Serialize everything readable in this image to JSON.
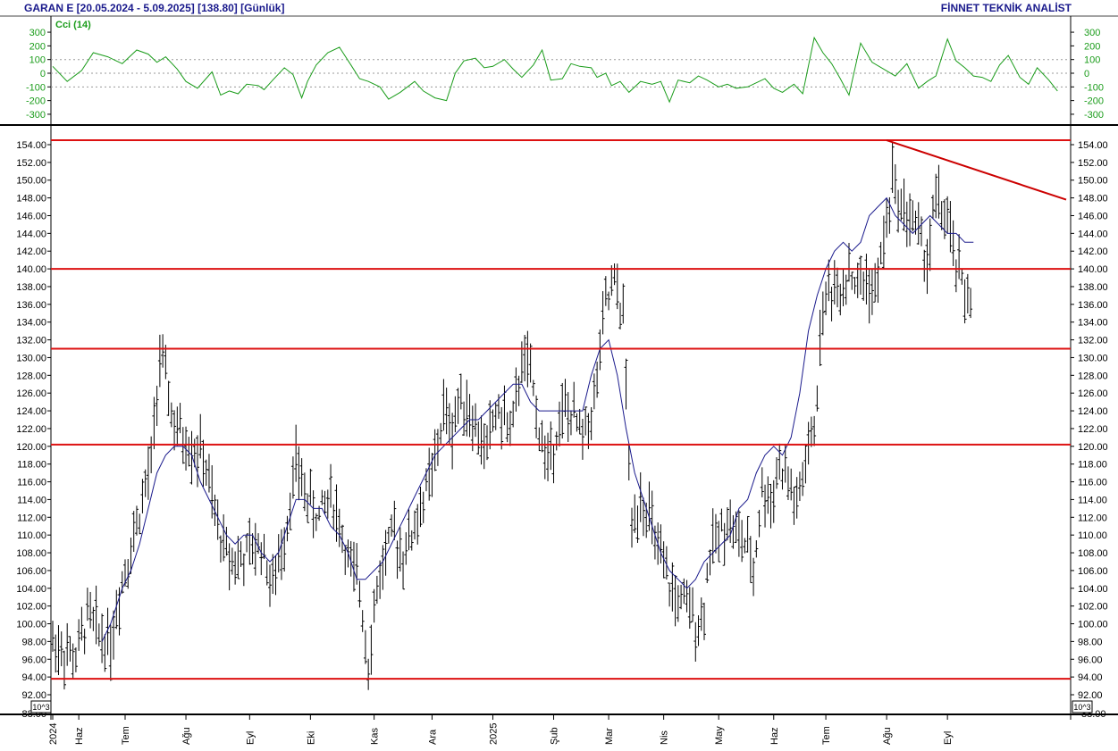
{
  "header": {
    "title": "GARAN E  [20.05.2024 - 5.09.2025]  [138.80]  [Günlük]",
    "brand": "FİNNET TEKNİK ANALİST"
  },
  "chart_data": [
    {
      "type": "line",
      "title": "Cci (14)",
      "ylim": [
        -340,
        340
      ],
      "yticks": [
        300,
        200,
        100,
        0,
        -100,
        -200,
        -300
      ],
      "ytick_labels": [
        "300",
        "200",
        "100",
        "0",
        "-100",
        "-200",
        "-300"
      ],
      "reference_lines": [
        100,
        -100
      ],
      "grid": false,
      "series": [
        {
          "name": "Cci (14)",
          "color": "#1a9c1a",
          "x": [
            0,
            5,
            10,
            14,
            19,
            24,
            29,
            33,
            36,
            39,
            43,
            46,
            50,
            55,
            58,
            61,
            64,
            67,
            71,
            73,
            76,
            80,
            83,
            86,
            88,
            91,
            95,
            99,
            103,
            106,
            109,
            113,
            116,
            120,
            125,
            128,
            132,
            136,
            139,
            142,
            146,
            149,
            152,
            156,
            159,
            162,
            166,
            169,
            172,
            176,
            179,
            182,
            186,
            188,
            191,
            193,
            196,
            199,
            203,
            207,
            210,
            213,
            216,
            220,
            223,
            226,
            230,
            233,
            236,
            240,
            243,
            246,
            249,
            252,
            256,
            259,
            263,
            266,
            269,
            272,
            275,
            279,
            283,
            287,
            291,
            295,
            299,
            302,
            305,
            309,
            312,
            315,
            318,
            321,
            324,
            327,
            330,
            334,
            337,
            340,
            344,
            347
          ],
          "values": [
            50,
            -60,
            20,
            150,
            120,
            70,
            170,
            140,
            80,
            120,
            30,
            -60,
            -110,
            10,
            -160,
            -130,
            -150,
            -80,
            -90,
            -120,
            -50,
            40,
            -10,
            -180,
            -60,
            60,
            150,
            190,
            60,
            -40,
            -60,
            -100,
            -190,
            -140,
            -60,
            -130,
            -180,
            -200,
            0,
            90,
            110,
            40,
            50,
            100,
            30,
            -30,
            60,
            170,
            -50,
            -40,
            70,
            50,
            40,
            -30,
            0,
            -90,
            -60,
            -140,
            -60,
            -80,
            -60,
            -210,
            -50,
            -70,
            -20,
            -50,
            -100,
            -80,
            -110,
            -100,
            -70,
            -40,
            -110,
            -140,
            -80,
            -150,
            260,
            150,
            70,
            -40,
            -160,
            220,
            80,
            30,
            -20,
            70,
            -110,
            -60,
            -20,
            250,
            90,
            40,
            -20,
            -30,
            -60,
            60,
            130,
            -30,
            -80,
            40,
            -50,
            -130
          ]
        }
      ]
    },
    {
      "type": "bar",
      "chart_style": "ohlc",
      "ylim": [
        88,
        156
      ],
      "yticks": [
        92,
        94,
        96,
        98,
        100,
        102,
        104,
        106,
        108,
        110,
        112,
        114,
        116,
        118,
        120,
        122,
        124,
        126,
        128,
        130,
        132,
        134,
        136,
        138,
        140,
        142,
        144,
        146,
        148,
        150,
        152,
        154
      ],
      "ytick_labels": [
        "92.00",
        "94.00",
        "96.00",
        "98.00",
        "100.00",
        "102.00",
        "104.00",
        "106.00",
        "108.00",
        "110.00",
        "112.00",
        "114.00",
        "116.00",
        "118.00",
        "120.00",
        "122.00",
        "124.00",
        "126.00",
        "128.00",
        "130.00",
        "132.00",
        "134.00",
        "136.00",
        "138.00",
        "140.00",
        "142.00",
        "144.00",
        "146.00",
        "148.00",
        "150.00",
        "152.00",
        "154.00"
      ],
      "bottom_tick_label": "88.00",
      "scale_badge": "10^3",
      "x_axis_labels": [
        {
          "label": "2024",
          "x": 0
        },
        {
          "label": "Haz",
          "x": 9
        },
        {
          "label": "Tem",
          "x": 25
        },
        {
          "label": "Ağu",
          "x": 46
        },
        {
          "label": "Eyl",
          "x": 68
        },
        {
          "label": "Eki",
          "x": 89
        },
        {
          "label": "Kas",
          "x": 111
        },
        {
          "label": "Ara",
          "x": 131
        },
        {
          "label": "2025",
          "x": 152
        },
        {
          "label": "Şub",
          "x": 173
        },
        {
          "label": "Mar",
          "x": 192
        },
        {
          "label": "Nis",
          "x": 211
        },
        {
          "label": "May",
          "x": 230
        },
        {
          "label": "Haz",
          "x": 249
        },
        {
          "label": "Tem",
          "x": 267
        },
        {
          "label": "Ağu",
          "x": 288
        },
        {
          "label": "Eyl",
          "x": 309
        }
      ],
      "horizontal_levels": [
        154.5,
        140.0,
        131.0,
        120.2,
        93.8
      ],
      "trendline": {
        "x": [
          288,
          350
        ],
        "y": [
          154.5,
          147.8
        ],
        "color": "#cc0000"
      },
      "ohlc_trend": {
        "x": [
          0,
          4,
          8,
          12,
          16,
          20,
          24,
          28,
          31,
          34,
          37,
          40,
          42,
          45,
          48,
          52,
          56,
          60,
          64,
          68,
          72,
          76,
          80,
          84,
          88,
          92,
          96,
          100,
          103,
          106,
          109,
          112,
          115,
          118,
          121,
          124,
          128,
          132,
          135,
          138,
          141,
          144,
          147,
          150,
          153,
          156,
          159,
          162,
          165,
          168,
          171,
          174,
          177,
          180,
          183,
          187,
          191,
          194,
          197,
          200,
          203,
          206,
          209,
          212,
          215,
          218,
          221,
          224,
          227,
          230,
          233,
          236,
          239,
          242,
          245,
          248,
          251,
          254,
          257,
          260,
          263,
          266,
          269,
          272,
          275,
          278,
          281,
          284,
          287,
          290,
          293,
          296,
          299,
          302,
          305,
          308,
          311,
          314,
          317
        ],
        "values": [
          98,
          97,
          96,
          101,
          99,
          98,
          105,
          110,
          114,
          118,
          130,
          126,
          122,
          121,
          120,
          119,
          112,
          108,
          107,
          108,
          109,
          104,
          110,
          118,
          114,
          112,
          115,
          110,
          106,
          104,
          96,
          104,
          108,
          110,
          108,
          110,
          114,
          118,
          124,
          122,
          126,
          124,
          121,
          120,
          124,
          123,
          122,
          130,
          128,
          122,
          118,
          122,
          124,
          123,
          121,
          125,
          136,
          138,
          135,
          110,
          115,
          112,
          108,
          105,
          103,
          102,
          101,
          100,
          108,
          110,
          112,
          110,
          109,
          106,
          115,
          114,
          118,
          116,
          113,
          118,
          122,
          136,
          138,
          138,
          140,
          138,
          139,
          137,
          143,
          150,
          147,
          146,
          144,
          141,
          148,
          146,
          142,
          138,
          137
        ]
      },
      "series": [
        {
          "name": "",
          "color": "#1a1a8c",
          "x": [
            17,
            20,
            24,
            27,
            30,
            33,
            36,
            39,
            42,
            45,
            48,
            51,
            54,
            57,
            60,
            63,
            66,
            69,
            72,
            75,
            78,
            81,
            84,
            87,
            90,
            93,
            96,
            99,
            102,
            105,
            108,
            111,
            114,
            117,
            120,
            123,
            126,
            129,
            132,
            135,
            138,
            141,
            144,
            147,
            150,
            153,
            156,
            159,
            162,
            165,
            168,
            171,
            174,
            177,
            180,
            183,
            186,
            189,
            192,
            195,
            198,
            201,
            204,
            207,
            210,
            213,
            216,
            219,
            222,
            225,
            228,
            231,
            234,
            237,
            240,
            243,
            246,
            249,
            252,
            255,
            258,
            261,
            264,
            267,
            270,
            273,
            276,
            279,
            282,
            285,
            288,
            291,
            294,
            297,
            300,
            303,
            306,
            309,
            312,
            315,
            318
          ],
          "values": [
            98,
            100,
            104,
            106,
            109,
            113,
            117,
            119,
            120,
            120,
            119,
            116,
            114,
            112,
            110,
            109,
            110,
            110,
            108,
            107,
            108,
            111,
            114,
            114,
            113,
            113,
            111,
            110,
            108,
            105,
            105,
            106,
            107,
            109,
            111,
            113,
            115,
            117,
            119,
            120,
            121,
            122,
            123,
            123,
            124,
            125,
            126,
            127,
            127,
            125,
            124,
            124,
            124,
            124,
            124,
            124,
            128,
            131,
            132,
            128,
            122,
            117,
            114,
            111,
            108,
            106,
            105,
            104,
            105,
            107,
            108,
            109,
            110,
            113,
            114,
            117,
            119,
            120,
            119,
            121,
            126,
            133,
            137,
            140,
            142,
            143,
            142,
            143,
            146,
            147,
            148,
            146,
            145,
            144,
            145,
            146,
            145,
            144,
            144,
            143,
            143
          ]
        }
      ]
    }
  ]
}
